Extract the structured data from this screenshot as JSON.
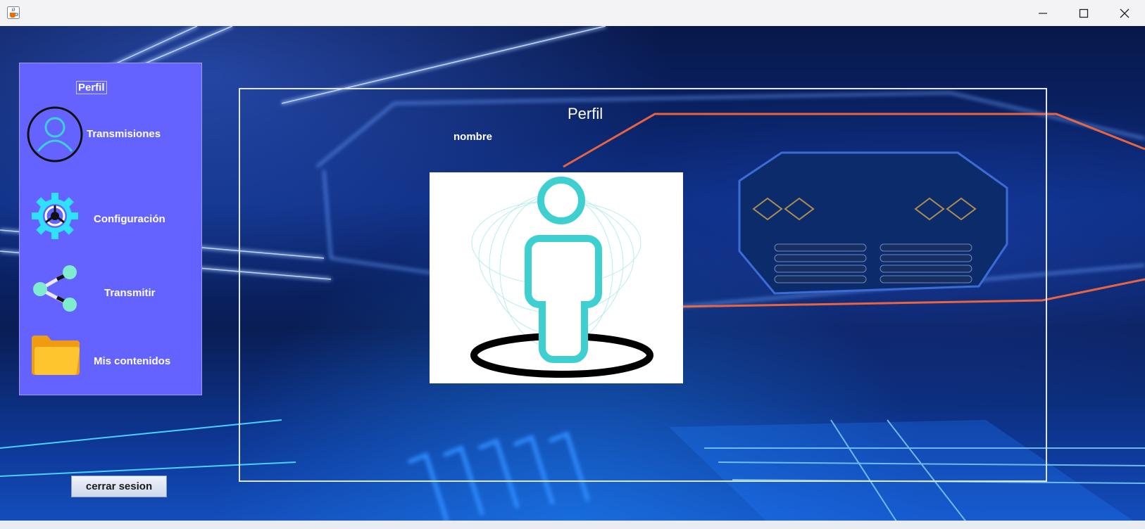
{
  "window": {
    "app_icon": "java-cup-icon",
    "controls": [
      "minimize-icon",
      "maximize-icon",
      "close-icon"
    ]
  },
  "sidebar": {
    "header_label": "Perfil",
    "items": [
      {
        "label": "Transmisiones",
        "icon": "user-circle-icon"
      },
      {
        "label": "Configuración",
        "icon": "gear-icon"
      },
      {
        "label": "Transmitir",
        "icon": "share-icon"
      },
      {
        "label": "Mis contenidos",
        "icon": "folder-icon"
      }
    ]
  },
  "main": {
    "title": "Perfil",
    "name_label": "nombre",
    "avatar_icon": "profile-avatar-icon"
  },
  "footer": {
    "logout_label": "cerrar sesion"
  },
  "colors": {
    "sidebar_bg": "#6463ff",
    "accent_cyan": "#3ecfd0",
    "titlebar_bg": "#f3f2f5"
  }
}
